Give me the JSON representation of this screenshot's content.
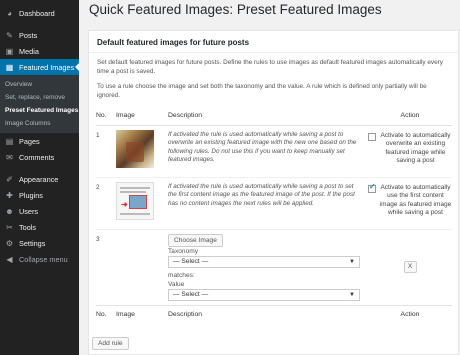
{
  "sidebar": {
    "items": [
      {
        "icon": "dashboard-icon",
        "glyph": "◕",
        "label": "Dashboard"
      },
      {
        "icon": "pin-icon",
        "glyph": "✎",
        "label": "Posts"
      },
      {
        "icon": "media-icon",
        "glyph": "▣",
        "label": "Media"
      },
      {
        "icon": "featured-images-icon",
        "glyph": "▦",
        "label": "Featured Images"
      },
      {
        "icon": "pages-icon",
        "glyph": "▤",
        "label": "Pages"
      },
      {
        "icon": "comments-icon",
        "glyph": "✉",
        "label": "Comments"
      },
      {
        "icon": "appearance-icon",
        "glyph": "✐",
        "label": "Appearance"
      },
      {
        "icon": "plugins-icon",
        "glyph": "✚",
        "label": "Plugins"
      },
      {
        "icon": "users-icon",
        "glyph": "☻",
        "label": "Users"
      },
      {
        "icon": "tools-icon",
        "glyph": "✂",
        "label": "Tools"
      },
      {
        "icon": "settings-icon",
        "glyph": "⚙",
        "label": "Settings"
      },
      {
        "icon": "collapse-icon",
        "glyph": "◀",
        "label": "Collapse menu"
      }
    ],
    "submenu": [
      "Overview",
      "Set, replace, remove",
      "Preset Featured Images",
      "Image Columns"
    ]
  },
  "page": {
    "title": "Quick Featured Images: Preset Featured Images",
    "box_title": "Default featured images for future posts",
    "desc1": "Set default featured images for future posts. Define the rules to use images as default featured images automatically every time a post is saved.",
    "desc2": "To use a rule choose the image and set both the taxonomy and the value. A rule which is defined only partially will be ignored."
  },
  "table": {
    "headers": {
      "no": "No.",
      "image": "Image",
      "description": "Description",
      "action": "Action"
    },
    "rows": [
      {
        "no": "1",
        "description": "If activated the rule is used automatically while saving a post to overwrite an existing featured image with the new one based on the following rules. Do not use this if you want to keep manually set featured images.",
        "action": "Activate to automatically overwrite an existing featured image while saving a post",
        "checked": false
      },
      {
        "no": "2",
        "description": "If activated the rule is used automatically while saving a post to set the first content image as the featured image of the post. If the post has no content images the next rules will be applied.",
        "action": "Activate to automatically use the first content image as featured image while saving a post",
        "checked": true
      }
    ],
    "rule3": {
      "no": "3",
      "choose_image": "Choose Image",
      "taxonomy_label": "Taxonomy",
      "taxonomy_value": "— Select —",
      "matches_label": "matches:",
      "value_label": "Value",
      "value_value": "— Select —",
      "remove": "X"
    }
  },
  "add_rule": "Add rule"
}
